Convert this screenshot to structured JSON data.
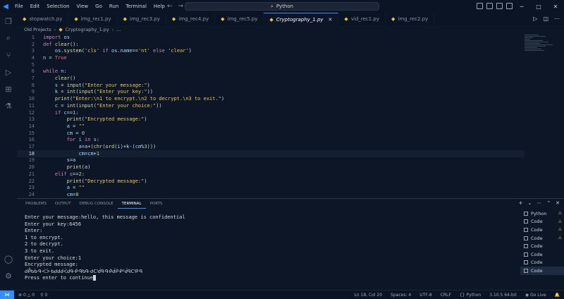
{
  "menu": [
    "File",
    "Edit",
    "Selection",
    "View",
    "Go",
    "Run",
    "Terminal",
    "Help"
  ],
  "command_center": "Python",
  "tabs": [
    {
      "label": "stopwatch.py",
      "active": false
    },
    {
      "label": "img_rec1.py",
      "active": false
    },
    {
      "label": "img_rec3.py",
      "active": false
    },
    {
      "label": "img_rec4.py",
      "active": false
    },
    {
      "label": "img_rec5.py",
      "active": false
    },
    {
      "label": "Cryptography_1.py",
      "active": true
    },
    {
      "label": "vid_rec1.py",
      "active": false
    },
    {
      "label": "img_rec2.py",
      "active": false
    }
  ],
  "breadcrumb": {
    "folder": "Old Projects",
    "file": "Cryptography_1.py",
    "more": "..."
  },
  "code_lines": [
    {
      "n": "1",
      "html": "<span class='kw'>import</span> <span class='var'>os</span>"
    },
    {
      "n": "2",
      "html": "<span class='kw'>def</span> <span class='fn'>clear</span>():"
    },
    {
      "n": "3",
      "html": "    <span class='var'>os</span>.<span class='fn'>system</span>(<span class='str'>'cls'</span> <span class='kw'>if</span> <span class='var'>os</span>.<span class='var'>name</span>==<span class='str'>'nt'</span> <span class='kw'>else</span> <span class='str'>'clear'</span>)"
    },
    {
      "n": "4",
      "html": "<span class='var'>n</span> = <span class='cons'>True</span>"
    },
    {
      "n": "5",
      "html": ""
    },
    {
      "n": "6",
      "html": "<span class='kw'>while</span> <span class='var'>n</span>:"
    },
    {
      "n": "7",
      "html": "    <span class='fn'>clear</span>()"
    },
    {
      "n": "8",
      "html": "    <span class='var'>s</span> = <span class='fn'>input</span>(<span class='str'>\"Enter your message:\"</span>)"
    },
    {
      "n": "9",
      "html": "    <span class='var'>k</span> = <span class='fn'>int</span>(<span class='fn'>input</span>(<span class='str'>\"Enter your key:\"</span>))"
    },
    {
      "n": "10",
      "html": "    <span class='fn'>print</span>(<span class='str'>\"Enter:\\n1 to encrypt.\\n2 to decrypt.\\n3 to exit.\"</span>)"
    },
    {
      "n": "11",
      "html": "    <span class='var'>c</span> = <span class='fn'>int</span>(<span class='fn'>input</span>(<span class='str'>\"Enter your choice:\"</span>))"
    },
    {
      "n": "12",
      "html": "    <span class='kw'>if</span> <span class='var'>c</span>==<span class='num'>1</span>:"
    },
    {
      "n": "13",
      "html": "        <span class='fn'>print</span>(<span class='str'>\"Encrypted message:\"</span>)"
    },
    {
      "n": "14",
      "html": "        <span class='var'>a</span> = <span class='str'>\"\"</span>"
    },
    {
      "n": "15",
      "html": "        <span class='var'>cm</span> = <span class='num'>0</span>"
    },
    {
      "n": "16",
      "html": "        <span class='kw'>for</span> <span class='var'>i</span> <span class='kw'>in</span> <span class='var'>s</span>:"
    },
    {
      "n": "17",
      "html": "            <span class='var'>a</span>=<span class='var'>a</span>+(<span class='fn'>chr</span>(<span class='fn'>ord</span>(<span class='var'>i</span>)+<span class='var'>k</span>-(<span class='var'>cm</span>%<span class='num'>3</span>)))"
    },
    {
      "n": "18",
      "html": "            <span class='var'>cm</span>=<span class='var'>cm</span>+<span class='num'>1</span>",
      "current": true
    },
    {
      "n": "19",
      "html": "        <span class='var'>s</span>=<span class='var'>a</span>"
    },
    {
      "n": "20",
      "html": "        <span class='fn'>print</span>(<span class='var'>a</span>)"
    },
    {
      "n": "21",
      "html": "    <span class='kw'>elif</span> <span class='var'>c</span>==<span class='num'>2</span>:"
    },
    {
      "n": "22",
      "html": "        <span class='fn'>print</span>(<span class='str'>\"Decrypted message:\"</span>)"
    },
    {
      "n": "23",
      "html": "        <span class='var'>a</span> = <span class='str'>\"\"</span>"
    },
    {
      "n": "24",
      "html": "        <span class='var'>cm</span>=<span class='num'>0</span>"
    }
  ],
  "panel_tabs": [
    "PROBLEMS",
    "OUTPUT",
    "DEBUG CONSOLE",
    "TERMINAL",
    "PORTS"
  ],
  "active_panel_tab": "TERMINAL",
  "terminal_lines": [
    "Enter your message:hello, this message is confidential",
    "Enter your key:6456",
    "Enter:",
    "1 to encrypt.",
    "2 to decrypt.",
    "3 to exit.",
    "Enter your choice:1",
    "Encrypted message:",
    "ᑯᑬᑲᑳᑴᑆᑃᑲᑯᑯᑰᑈᑰᑵᑸᑴᑲᑵᑺᑪᑰᑫᑴᑸᑱᑮᑸᑦᑱᑫᑪᑭᑴ",
    "Press enter to continue"
  ],
  "terminal_instances": [
    {
      "label": "Python",
      "warn": true
    },
    {
      "label": "Code",
      "warn": true
    },
    {
      "label": "Code",
      "warn": true
    },
    {
      "label": "Code",
      "warn": true
    },
    {
      "label": "Code",
      "warn": false
    },
    {
      "label": "Code",
      "warn": false
    },
    {
      "label": "Code",
      "warn": false
    },
    {
      "label": "Code",
      "warn": false,
      "active": true
    }
  ],
  "status": {
    "errors": "0",
    "warnings": "0",
    "info": "0",
    "position": "Ln 18, Col 20",
    "spaces": "Spaces: 4",
    "encoding": "UTF-8",
    "eol": "CRLF",
    "language": "Python",
    "interpreter": "3.10.5 64-bit",
    "golive": "Go Live"
  },
  "colors": {
    "accent": "#2f8fff",
    "background": "#0d1626",
    "keyword": "#c586c0",
    "string": "#e8c547"
  }
}
